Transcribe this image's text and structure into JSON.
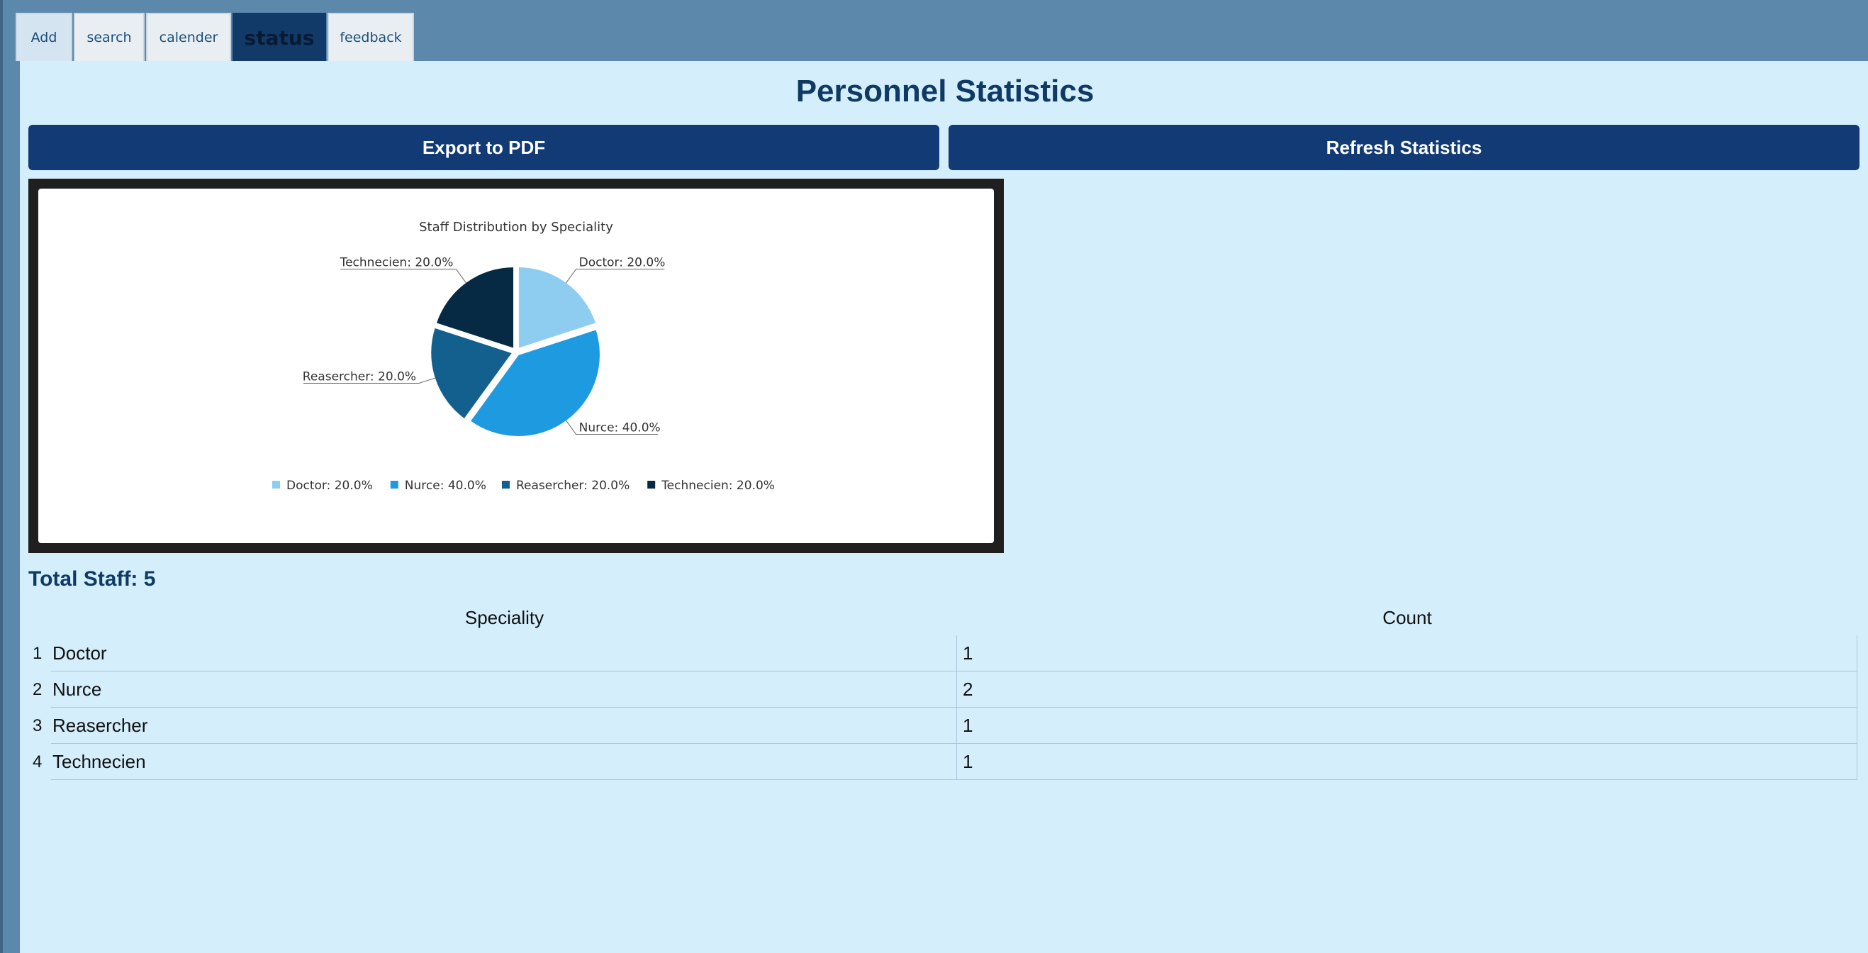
{
  "tabs": [
    {
      "label": "Add",
      "active": false
    },
    {
      "label": "search",
      "active": false
    },
    {
      "label": "calender",
      "active": false
    },
    {
      "label": "status",
      "active": true
    },
    {
      "label": "feedback",
      "active": false
    }
  ],
  "page": {
    "title": "Personnel Statistics",
    "export_label": "Export to PDF",
    "refresh_label": "Refresh Statistics",
    "total_staff": "Total Staff: 5"
  },
  "table": {
    "columns": [
      "Speciality",
      "Count"
    ],
    "rows": [
      {
        "index": "1",
        "speciality": "Doctor",
        "count": "1"
      },
      {
        "index": "2",
        "speciality": "Nurce",
        "count": "2"
      },
      {
        "index": "3",
        "speciality": "Reasercher",
        "count": "1"
      },
      {
        "index": "4",
        "speciality": "Technecien",
        "count": "1"
      }
    ]
  },
  "colors": {
    "tab_active": "#123a69",
    "button": "#123a74",
    "content_bg": "#d4eefc",
    "frame_bg": "#5c88ab"
  },
  "chart_data": {
    "type": "pie",
    "title": "Staff Distribution by Speciality",
    "legend_position": "bottom",
    "slices": [
      {
        "label": "Doctor",
        "value": 20.0,
        "display": "Doctor: 20.0%",
        "color": "#8ecdf0"
      },
      {
        "label": "Nurce",
        "value": 40.0,
        "display": "Nurce: 40.0%",
        "color": "#1e9ae0"
      },
      {
        "label": "Reasercher",
        "value": 20.0,
        "display": "Reasercher: 20.0%",
        "color": "#13608f"
      },
      {
        "label": "Technecien",
        "value": 20.0,
        "display": "Technecien: 20.0%",
        "color": "#062a44"
      }
    ]
  }
}
